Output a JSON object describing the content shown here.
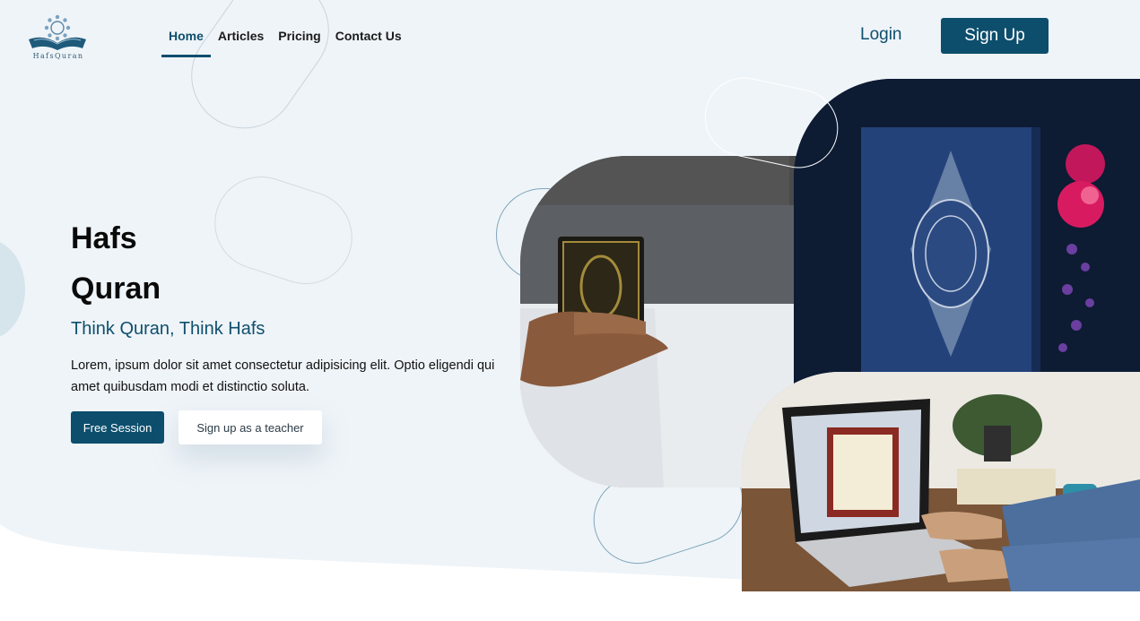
{
  "brand": {
    "logo_text": "HafsQuran"
  },
  "nav": {
    "items": [
      {
        "label": "Home",
        "active": true
      },
      {
        "label": "Articles",
        "active": false
      },
      {
        "label": "Pricing",
        "active": false
      },
      {
        "label": "Contact Us",
        "active": false
      }
    ]
  },
  "header": {
    "login_label": "Login",
    "signup_label": "Sign Up"
  },
  "hero": {
    "title_line1": "Hafs",
    "title_line2": "Quran",
    "subtitle": "Think Quran, Think Hafs",
    "description": "Lorem, ipsum dolor sit amet consectetur adipisicing elit. Optio eligendi qui amet quibusdam modi et distinctio soluta.",
    "primary_button": "Free Session",
    "secondary_button": "Sign up as a teacher"
  },
  "colors": {
    "accent": "#0d4e6d",
    "hero_background": "#eff4f8",
    "page_background": "#ffffff"
  },
  "images": [
    {
      "name": "man-holding-quran-photo"
    },
    {
      "name": "blue-quran-book-photo"
    },
    {
      "name": "laptop-quran-study-photo"
    }
  ]
}
